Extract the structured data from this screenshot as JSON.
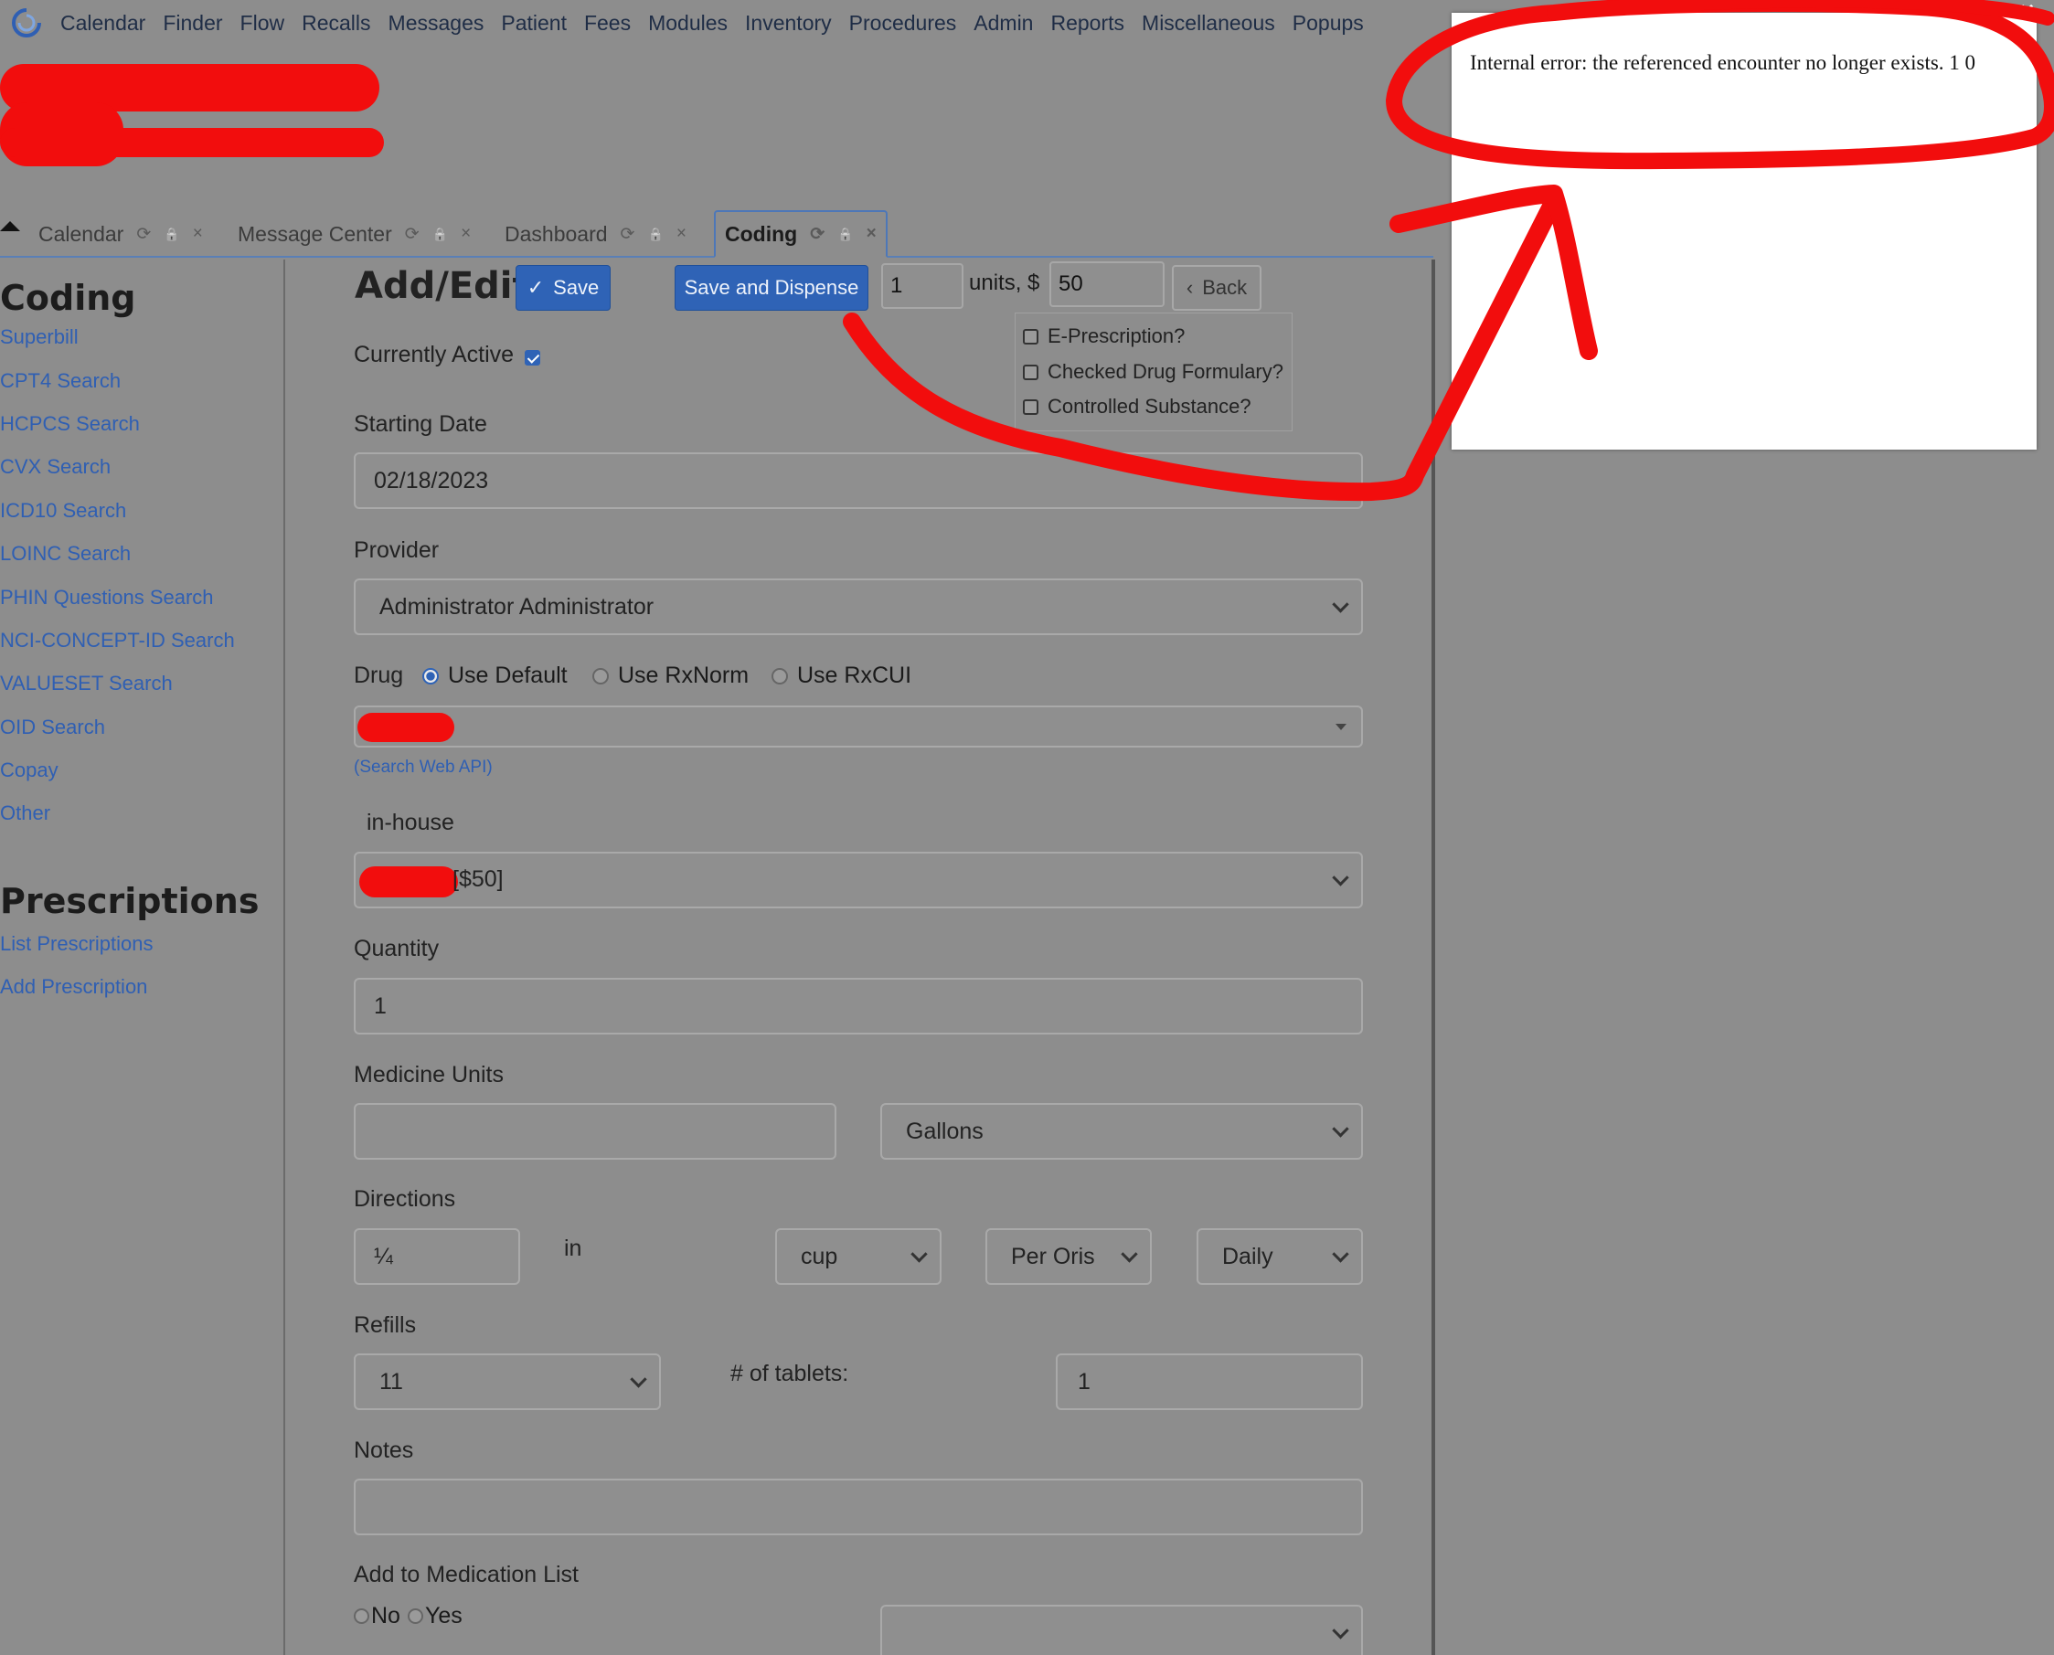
{
  "top_menu": [
    "Calendar",
    "Finder",
    "Flow",
    "Recalls",
    "Messages",
    "Patient",
    "Fees",
    "Modules",
    "Inventory",
    "Procedures",
    "Admin",
    "Reports",
    "Miscellaneous",
    "Popups"
  ],
  "tabs": [
    {
      "label": "Calendar"
    },
    {
      "label": "Message Center"
    },
    {
      "label": "Dashboard"
    },
    {
      "label": "Coding"
    }
  ],
  "tab_icons": {
    "refresh": "⟳",
    "lock": "🔒",
    "close": "×"
  },
  "sidebar": {
    "coding_heading": "Coding",
    "coding_links": [
      "Superbill",
      "CPT4 Search",
      "HCPCS Search",
      "CVX Search",
      "ICD10 Search",
      "LOINC Search",
      "PHIN Questions Search",
      "NCI-CONCEPT-ID Search",
      "VALUESET Search",
      "OID Search",
      "Copay",
      "Other"
    ],
    "prescriptions_heading": "Prescriptions",
    "prescription_links": [
      "List Prescriptions",
      "Add Prescription"
    ]
  },
  "form": {
    "title": "Add/Edit",
    "save_label": "Save",
    "save_dispense_label": "Save and Dispense",
    "dispense_units": "1",
    "units_text": "units, $",
    "dispense_price": "50",
    "back_label": "Back",
    "e_prescription": "E-Prescription?",
    "checked_formulary": "Checked Drug Formulary?",
    "controlled_substance": "Controlled Substance?",
    "currently_active_label": "Currently Active",
    "starting_date_label": "Starting Date",
    "starting_date_value": "02/18/2023",
    "provider_label": "Provider",
    "provider_value": "Administrator Administrator",
    "drug_label": "Drug",
    "drug_options": [
      "Use Default",
      "Use RxNorm",
      "Use RxCUI"
    ],
    "search_web_api": "(Search Web API)",
    "inhouse_label": "in-house",
    "inhouse_value_suffix": "[$50]",
    "quantity_label": "Quantity",
    "quantity_value": "1",
    "medicine_units_label": "Medicine Units",
    "medicine_units_value": "",
    "medicine_units_select": "Gallons",
    "directions_label": "Directions",
    "directions_amount": "¼",
    "directions_in": "in",
    "directions_form": "cup",
    "directions_route": "Per Oris",
    "directions_interval": "Daily",
    "refills_label": "Refills",
    "refills_value": "11",
    "tablets_label": "# of tablets:",
    "tablets_value": "1",
    "notes_label": "Notes",
    "notes_value": "",
    "add_med_list_label": "Add to Medication List",
    "med_list_no": "No",
    "med_list_yes": "Yes"
  },
  "popup": {
    "message": "Internal error: the referenced encounter no longer exists. 1 0",
    "close": "×"
  },
  "colors": {
    "annotation_red": "#f20d0d",
    "primary_button": "#2f63b6",
    "link": "#2f5fb3",
    "overlay_background": "#8d8d8d"
  }
}
